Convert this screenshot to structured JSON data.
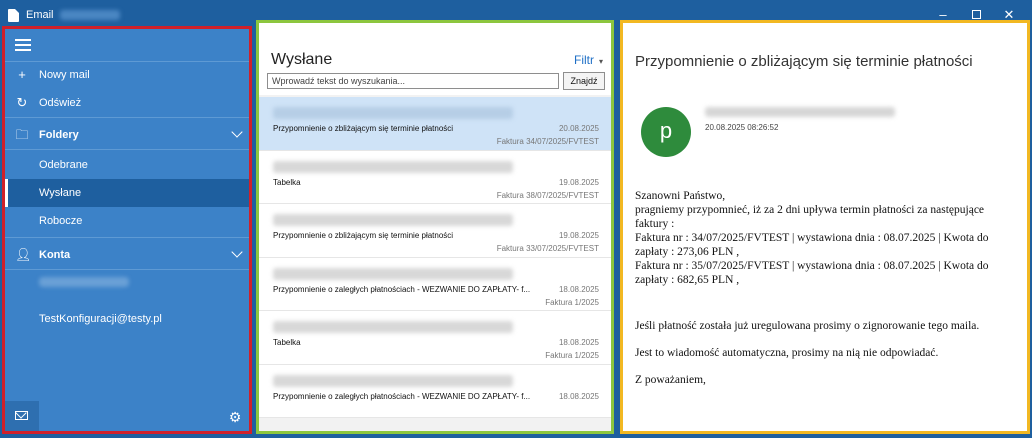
{
  "window": {
    "title": "Email"
  },
  "sidebar": {
    "new_mail": "Nowy mail",
    "refresh": "Odśwież",
    "folders": "Foldery",
    "folder_items": [
      "Odebrane",
      "Wysłane",
      "Robocze"
    ],
    "accounts": "Konta",
    "account_items": [
      "TestKonfiguracji@testy.pl"
    ]
  },
  "list": {
    "title": "Wysłane",
    "filter": "Filtr",
    "search_placeholder": "Wprowadź tekst do wyszukania...",
    "search_button": "Znajdź",
    "messages": [
      {
        "subject": "Przypomnienie o zbliżającym się terminie płatności",
        "date": "20.08.2025",
        "ref": "Faktura 34/07/2025/FVTEST"
      },
      {
        "subject": "Tabelka",
        "date": "19.08.2025",
        "ref": "Faktura 38/07/2025/FVTEST"
      },
      {
        "subject": "Przypomnienie o zbliżającym się terminie płatności",
        "date": "19.08.2025",
        "ref": "Faktura 33/07/2025/FVTEST"
      },
      {
        "subject": "Przypomnienie o zaległych płatnościach - WEZWANIE DO ZAPŁATY- f...",
        "date": "18.08.2025",
        "ref": "Faktura 1/2025"
      },
      {
        "subject": "Tabelka",
        "date": "18.08.2025",
        "ref": "Faktura 1/2025"
      },
      {
        "subject": "Przypomnienie o zaległych płatnościach - WEZWANIE DO ZAPŁATY- f...",
        "date": "18.08.2025",
        "ref": ""
      }
    ]
  },
  "reader": {
    "subject": "Przypomnienie o zbliżającym się terminie płatności",
    "avatar_letter": "p",
    "date": "20.08.2025 08:26:52",
    "body": {
      "greeting": "Szanowni Państwo,",
      "line1": "pragniemy przypomnieć, iż za 2 dni upływa termin płatności za następujące faktury :",
      "line2": "Faktura nr : 34/07/2025/FVTEST | wystawiona dnia : 08.07.2025 | Kwota do zapłaty : 273,06 PLN ,",
      "line3": "Faktura nr : 35/07/2025/FVTEST | wystawiona dnia : 08.07.2025 | Kwota do zapłaty : 682,65 PLN ,",
      "para2": "Jeśli płatność została już uregulowana prosimy o zignorowanie tego maila.",
      "para3": "Jest to wiadomość automatyczna, prosimy na nią nie odpowiadać.",
      "closing": "Z poważaniem,"
    }
  }
}
